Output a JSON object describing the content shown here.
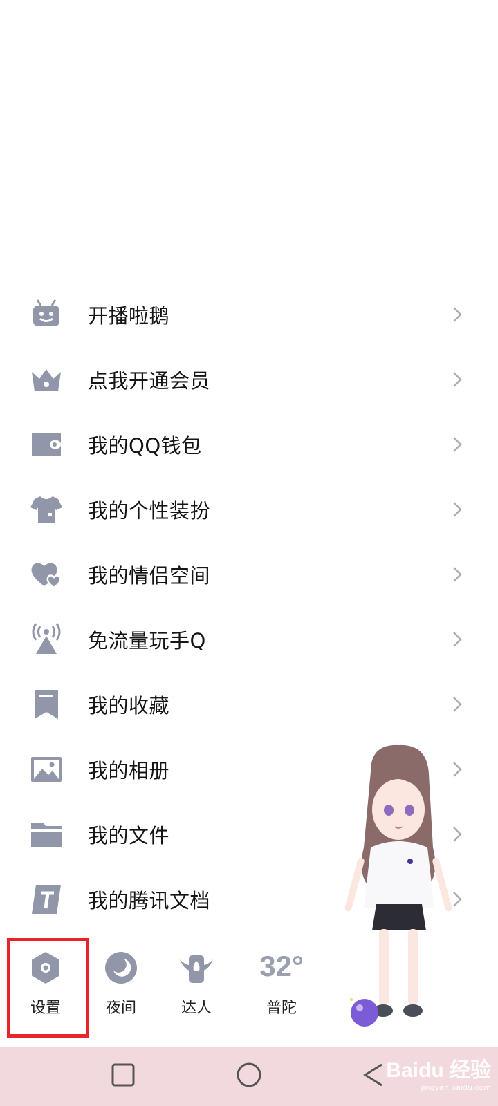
{
  "menu": {
    "items": [
      {
        "label": "开播啦鹅",
        "icon": "robot-icon"
      },
      {
        "label": "点我开通会员",
        "icon": "crown-icon"
      },
      {
        "label": "我的QQ钱包",
        "icon": "wallet-icon"
      },
      {
        "label": "我的个性装扮",
        "icon": "tshirt-icon"
      },
      {
        "label": "我的情侣空间",
        "icon": "hearts-icon"
      },
      {
        "label": "免流量玩手Q",
        "icon": "signal-tower-icon"
      },
      {
        "label": "我的收藏",
        "icon": "bookmark-icon"
      },
      {
        "label": "我的相册",
        "icon": "image-icon"
      },
      {
        "label": "我的文件",
        "icon": "folder-icon"
      },
      {
        "label": "我的腾讯文档",
        "icon": "document-icon"
      }
    ]
  },
  "toolbar": {
    "settings_label": "设置",
    "night_label": "夜间",
    "expert_label": "达人",
    "weather_temp": "32°",
    "weather_city": "普陀"
  },
  "watermark": {
    "brand": "Baidu 经验",
    "url": "jingyan.baidu.com"
  },
  "colors": {
    "icon_gray": "#9197a8",
    "highlight_red": "#e8252a",
    "navbar_pink": "#f1d9de"
  }
}
